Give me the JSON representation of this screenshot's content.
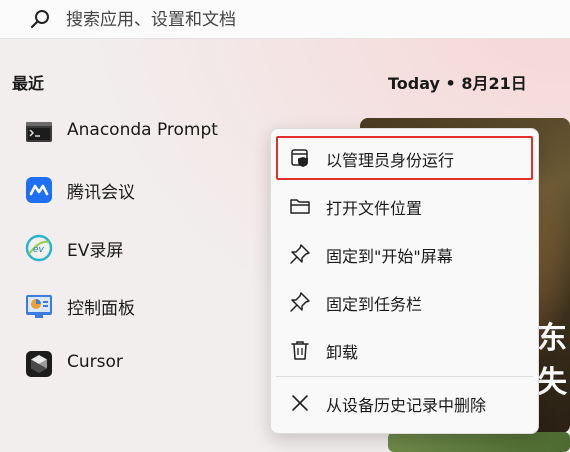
{
  "search": {
    "placeholder": "搜索应用、设置和文档"
  },
  "recent": {
    "title": "最近",
    "date_label": "Today • 8月21日",
    "items": [
      {
        "label": "Anaconda Prompt",
        "icon": "terminal-icon"
      },
      {
        "label": "腾讯会议",
        "icon": "tencent-meeting-icon"
      },
      {
        "label": "EV录屏",
        "icon": "ev-recorder-icon"
      },
      {
        "label": "控制面板",
        "icon": "control-panel-icon"
      },
      {
        "label": "Cursor",
        "icon": "cursor-icon"
      }
    ]
  },
  "wallpaper": {
    "text": "东失"
  },
  "context_menu": {
    "items": [
      {
        "label": "以管理员身份运行",
        "icon": "shield-icon",
        "highlighted": true
      },
      {
        "label": "打开文件位置",
        "icon": "folder-icon"
      },
      {
        "label": "固定到\"开始\"屏幕",
        "icon": "pin-icon"
      },
      {
        "label": "固定到任务栏",
        "icon": "pin-icon"
      },
      {
        "label": "卸载",
        "icon": "trash-icon"
      },
      {
        "label": "从设备历史记录中删除",
        "icon": "close-icon"
      }
    ]
  },
  "colors": {
    "highlight_border": "#e0302a",
    "tencent_blue": "#1f6ff2"
  }
}
